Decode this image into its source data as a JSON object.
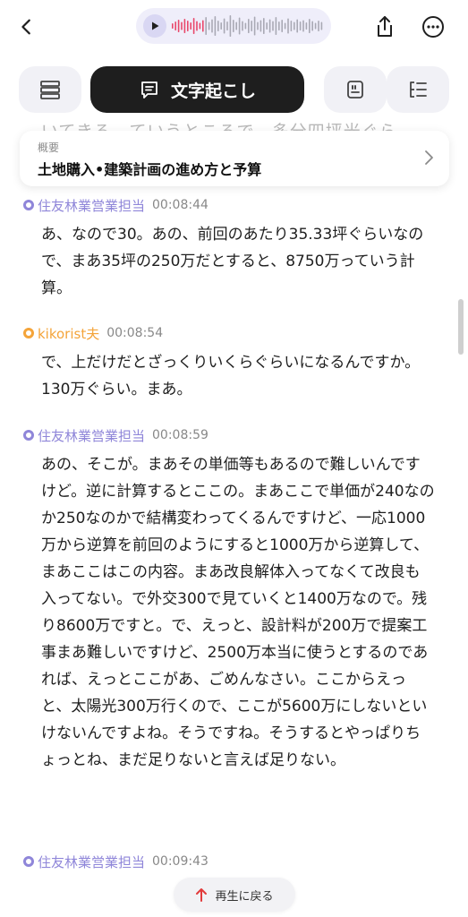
{
  "header": {
    "back_icon": "chevron-left-icon",
    "audio": {
      "play_icon": "play-icon",
      "waveform_icon": "waveform-icon",
      "accent": "#e9476a"
    },
    "share_icon": "share-icon",
    "more_icon": "more-horizontal-icon"
  },
  "tabs": {
    "items": [
      {
        "icon": "list-icon"
      },
      {
        "icon": "chat-bubble-icon",
        "label": "文字起こし"
      },
      {
        "icon": "quote-icon"
      },
      {
        "icon": "outline-icon"
      }
    ],
    "active_index": 1
  },
  "transcript": {
    "ghost_text": "いてきる、ていうところで、多分四坪光ぐら",
    "summary": {
      "label": "概要",
      "title": "土地購入•建築計画の進め方と予算"
    },
    "entries": [
      {
        "speaker": "住友林業営業担当",
        "time": "00:08:44",
        "color": "#8f86d9",
        "text": "あ、なので30。あの、前回のあたり35.33坪ぐらいなので、まあ35坪の250万だとすると、8750万っていう計算。"
      },
      {
        "speaker": "kikorist夫",
        "time": "00:08:54",
        "color": "#f4a43a",
        "text": "で、上だけだとざっくりいくらぐらいになるんですか。130万ぐらい。まあ。"
      },
      {
        "speaker": "住友林業営業担当",
        "time": "00:08:59",
        "color": "#8f86d9",
        "text": "あの、そこが。まあその単価等もあるので難しいんですけど。逆に計算するとここの。まあここで単価が240なのか250なのかで結構変わってくるんですけど、一応1000万から逆算を前回のようにすると1000万から逆算して、まあここはこの内容。まあ改良解体入ってなくて改良も入ってない。で外交300で見ていくと1400万なので。残り8600万ですと。で、えっと、設計料が200万で提案工事まあ難しいですけど、2500万本当に使うとするのであれば、えっとここがあ、ごめんなさい。ここからえっと、太陽光300万行くので、ここが5600万にしないといけないんですよね。そうですね。そうするとやっぱりちょっとね、まだ足りないと言えば足りない。"
      },
      {
        "speaker": "住友林業営業担当",
        "time": "00:09:43",
        "color": "#8f86d9",
        "text": ""
      }
    ]
  },
  "return_button": {
    "label": "再生に戻る",
    "icon": "arrow-up-icon",
    "accent": "#e23b3b"
  }
}
